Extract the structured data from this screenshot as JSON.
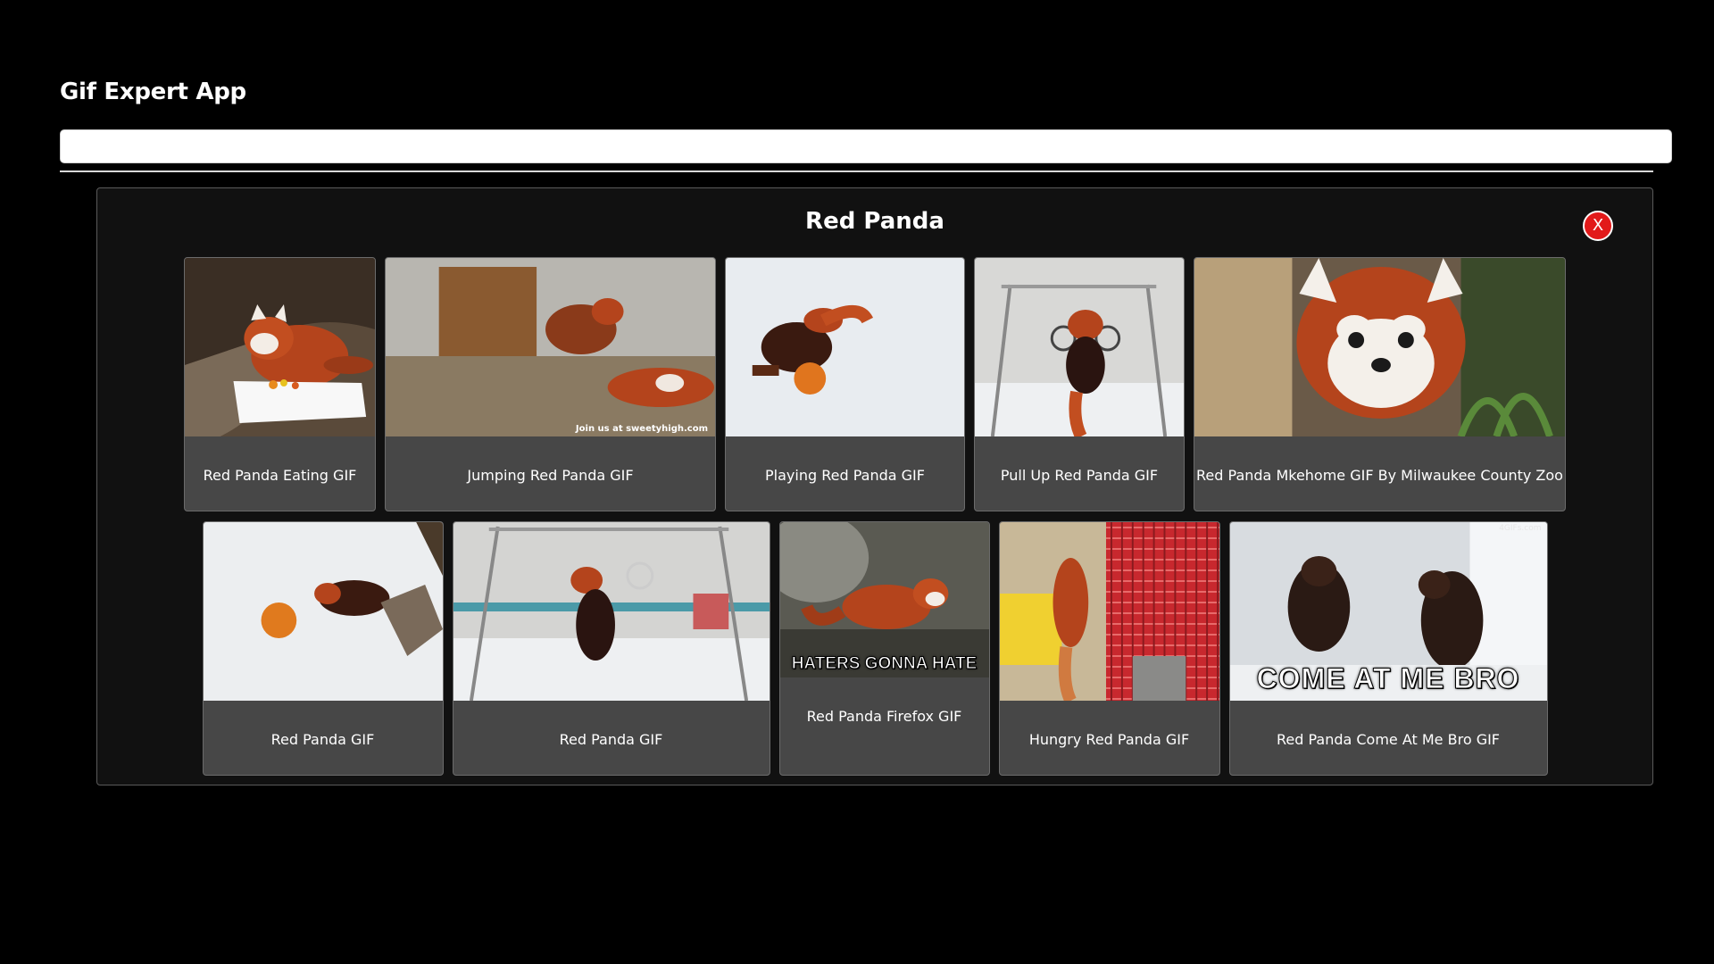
{
  "app": {
    "title": "Gif Expert App"
  },
  "search": {
    "value": "",
    "placeholder": ""
  },
  "category": {
    "title": "Red Panda",
    "close_label": "X"
  },
  "gifs_row_1": [
    {
      "title": "Red Panda Eating GIF"
    },
    {
      "title": "Jumping Red Panda GIF",
      "watermark": "Join us at sweetyhigh.com"
    },
    {
      "title": "Playing Red Panda GIF"
    },
    {
      "title": "Pull Up Red Panda GIF"
    },
    {
      "title": "Red Panda Mkehome GIF By Milwaukee County Zoo"
    }
  ],
  "gifs_row_2": [
    {
      "title": "Red Panda GIF"
    },
    {
      "title": "Red Panda GIF"
    },
    {
      "title": "Red Panda Firefox GIF",
      "overlay": "HATERS GONNA HATE"
    },
    {
      "title": "Hungry Red Panda GIF"
    },
    {
      "title": "Red Panda Come At Me Bro GIF",
      "overlay": "COME AT ME BRO",
      "watermark": "4GIFs.com"
    }
  ],
  "colors": {
    "background": "#000000",
    "panel": "#111111",
    "card": "#474747",
    "close_button": "#e21a1a",
    "panda_fur": "#b4441c"
  }
}
